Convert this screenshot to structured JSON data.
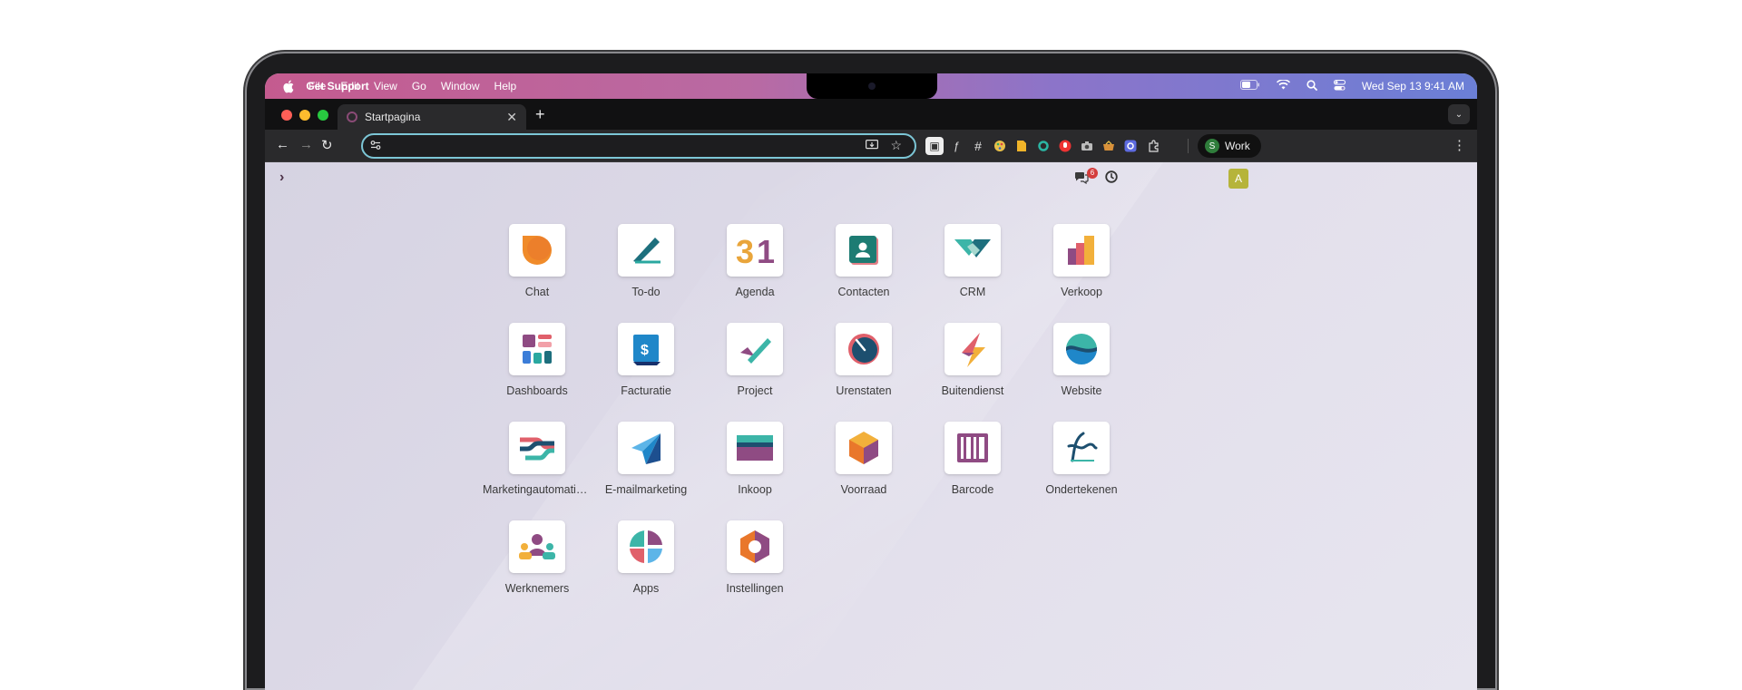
{
  "menubar": {
    "app_name": "Get Support",
    "menus": [
      "File",
      "Edit",
      "View",
      "Go",
      "Window",
      "Help"
    ],
    "clock": "Wed Sep 13  9:41 AM"
  },
  "browser": {
    "tab_title": "Startpagina",
    "url": "",
    "profile_initial": "S",
    "profile_label": "Work"
  },
  "page": {
    "notification_count": "6",
    "user_initial": "A",
    "apps": [
      {
        "label": "Chat",
        "icon": "chat-icon"
      },
      {
        "label": "To-do",
        "icon": "todo-icon"
      },
      {
        "label": "Agenda",
        "icon": "calendar-icon"
      },
      {
        "label": "Contacten",
        "icon": "contacts-icon"
      },
      {
        "label": "CRM",
        "icon": "crm-handshake-icon"
      },
      {
        "label": "Verkoop",
        "icon": "sales-chart-icon"
      },
      {
        "label": "Dashboards",
        "icon": "dashboards-icon"
      },
      {
        "label": "Facturatie",
        "icon": "invoice-icon"
      },
      {
        "label": "Project",
        "icon": "project-check-icon"
      },
      {
        "label": "Urenstaten",
        "icon": "timesheet-gauge-icon"
      },
      {
        "label": "Buitendienst",
        "icon": "field-service-icon"
      },
      {
        "label": "Website",
        "icon": "website-globe-icon"
      },
      {
        "label": "Marketingautomatisering",
        "icon": "marketing-automation-icon"
      },
      {
        "label": "E-mailmarketing",
        "icon": "paper-plane-icon"
      },
      {
        "label": "Inkoop",
        "icon": "purchase-card-icon"
      },
      {
        "label": "Voorraad",
        "icon": "inventory-box-icon"
      },
      {
        "label": "Barcode",
        "icon": "barcode-icon"
      },
      {
        "label": "Ondertekenen",
        "icon": "signature-icon"
      },
      {
        "label": "Werknemers",
        "icon": "employees-icon"
      },
      {
        "label": "Apps",
        "icon": "apps-icon"
      },
      {
        "label": "Instellingen",
        "icon": "settings-icon"
      }
    ]
  },
  "colors": {
    "accent_purple": "#714b67",
    "omnibox_focus": "#7cc6d6",
    "badge_red": "#d43d3d",
    "user_avatar": "#b6b43a"
  }
}
